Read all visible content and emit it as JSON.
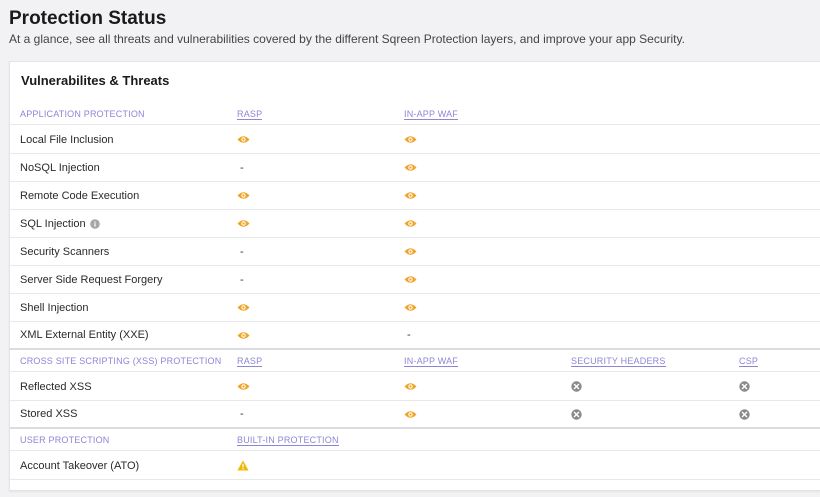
{
  "page": {
    "title": "Protection Status",
    "subtitle": "At a glance, see all threats and vulnerabilities covered by the different Sqreen Protection layers, and improve your app Security."
  },
  "card": {
    "title": "Vulnerabilites & Threats",
    "colors": {
      "accent": "#8d85d6",
      "eye": "#f0a325",
      "cross": "#8a8a8a",
      "warn": "#f2b705"
    },
    "sections": [
      {
        "headers": [
          "APPLICATION PROTECTION",
          "RASP",
          "IN-APP WAF"
        ],
        "rows": [
          {
            "name": "Local File Inclusion",
            "cells": [
              "eye",
              "eye"
            ]
          },
          {
            "name": "NoSQL Injection",
            "cells": [
              "-",
              "eye"
            ]
          },
          {
            "name": "Remote Code Execution",
            "cells": [
              "eye",
              "eye"
            ]
          },
          {
            "name": "SQL Injection",
            "info": true,
            "cells": [
              "eye",
              "eye"
            ]
          },
          {
            "name": "Security Scanners",
            "cells": [
              "-",
              "eye"
            ]
          },
          {
            "name": "Server Side Request Forgery",
            "cells": [
              "-",
              "eye"
            ]
          },
          {
            "name": "Shell Injection",
            "cells": [
              "eye",
              "eye"
            ]
          },
          {
            "name": "XML External Entity (XXE)",
            "cells": [
              "eye",
              "-"
            ]
          }
        ]
      },
      {
        "headers": [
          "CROSS SITE SCRIPTING (XSS) PROTECTION",
          "RASP",
          "IN-APP WAF",
          "SECURITY HEADERS",
          "CSP"
        ],
        "rows": [
          {
            "name": "Reflected XSS",
            "cells": [
              "eye",
              "eye",
              "cross",
              "cross"
            ]
          },
          {
            "name": "Stored XSS",
            "cells": [
              "-",
              "eye",
              "cross",
              "cross"
            ]
          }
        ]
      },
      {
        "headers": [
          "USER PROTECTION",
          "BUILT-IN PROTECTION"
        ],
        "rows": [
          {
            "name": "Account Takeover (ATO)",
            "cells": [
              "warning"
            ]
          }
        ]
      }
    ]
  }
}
